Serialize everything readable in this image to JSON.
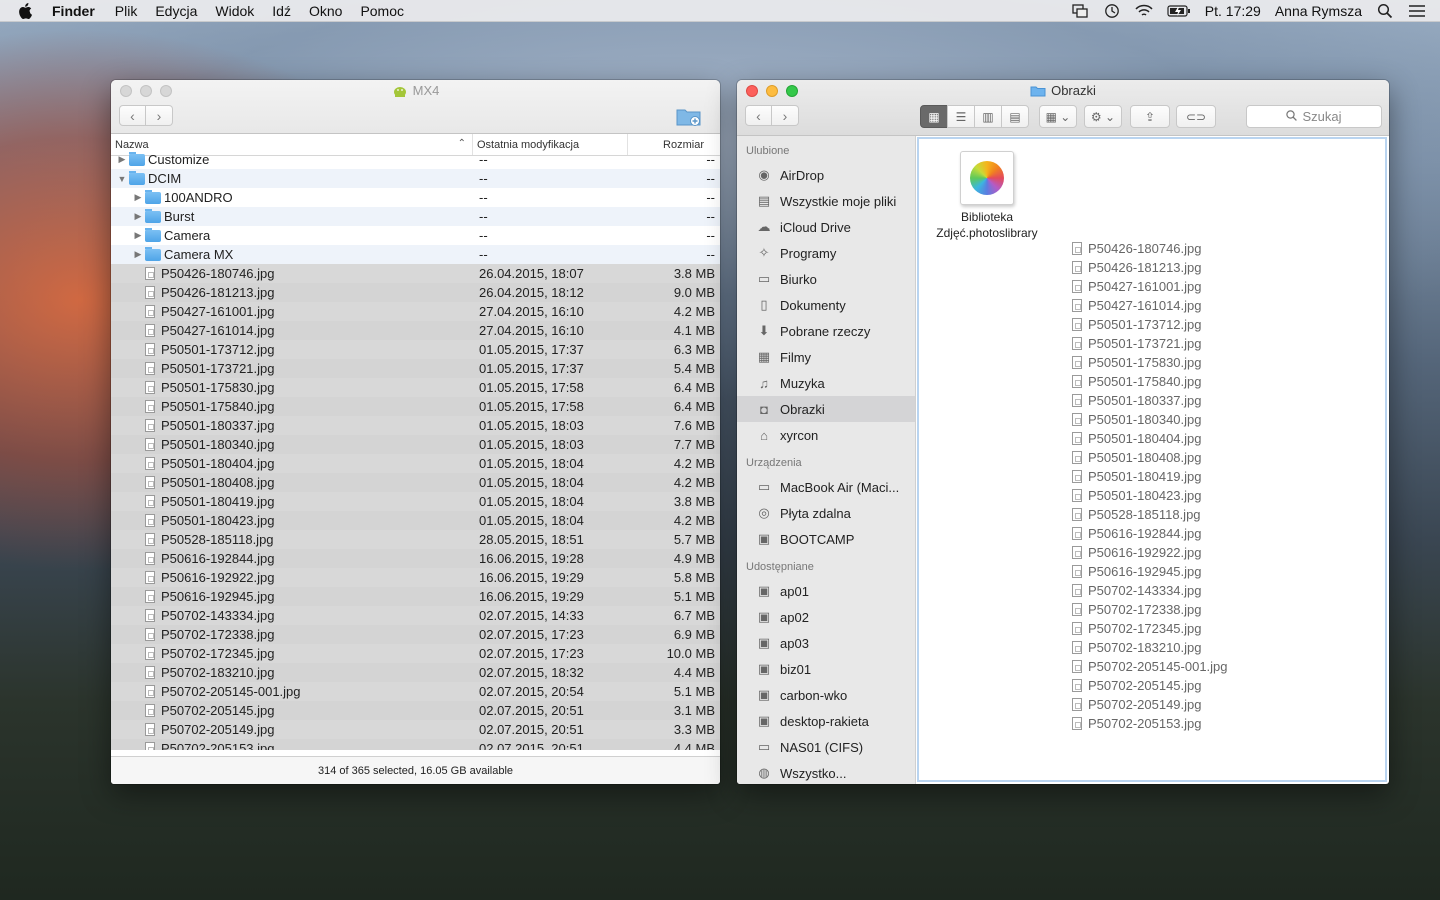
{
  "menubar": {
    "app": "Finder",
    "items": [
      "Plik",
      "Edycja",
      "Widok",
      "Idź",
      "Okno",
      "Pomoc"
    ],
    "clock": "Pt. 17:29",
    "user": "Anna Rymsza"
  },
  "mx4": {
    "title": "MX4",
    "columns": {
      "name": "Nazwa",
      "date": "Ostatnia modyfikacja",
      "size": "Rozmiar"
    },
    "rows": [
      {
        "level": 0,
        "kind": "folder",
        "tri": "▶",
        "name": "Customize",
        "date": "--",
        "size": "--",
        "sel": false
      },
      {
        "level": 0,
        "kind": "folder",
        "tri": "▼",
        "name": "DCIM",
        "date": "--",
        "size": "--",
        "sel": false
      },
      {
        "level": 1,
        "kind": "folder",
        "tri": "▶",
        "name": "100ANDRO",
        "date": "--",
        "size": "--",
        "sel": false
      },
      {
        "level": 1,
        "kind": "folder",
        "tri": "▶",
        "name": "Burst",
        "date": "--",
        "size": "--",
        "sel": false
      },
      {
        "level": 1,
        "kind": "folder",
        "tri": "▶",
        "name": "Camera",
        "date": "--",
        "size": "--",
        "sel": false
      },
      {
        "level": 1,
        "kind": "folder",
        "tri": "▶",
        "name": "Camera MX",
        "date": "--",
        "size": "--",
        "sel": false
      },
      {
        "level": 1,
        "kind": "file",
        "name": "P50426-180746.jpg",
        "date": "26.04.2015, 18:07",
        "size": "3.8 MB",
        "sel": true
      },
      {
        "level": 1,
        "kind": "file",
        "name": "P50426-181213.jpg",
        "date": "26.04.2015, 18:12",
        "size": "9.0 MB",
        "sel": true
      },
      {
        "level": 1,
        "kind": "file",
        "name": "P50427-161001.jpg",
        "date": "27.04.2015, 16:10",
        "size": "4.2 MB",
        "sel": true
      },
      {
        "level": 1,
        "kind": "file",
        "name": "P50427-161014.jpg",
        "date": "27.04.2015, 16:10",
        "size": "4.1 MB",
        "sel": true
      },
      {
        "level": 1,
        "kind": "file",
        "name": "P50501-173712.jpg",
        "date": "01.05.2015, 17:37",
        "size": "6.3 MB",
        "sel": true
      },
      {
        "level": 1,
        "kind": "file",
        "name": "P50501-173721.jpg",
        "date": "01.05.2015, 17:37",
        "size": "5.4 MB",
        "sel": true
      },
      {
        "level": 1,
        "kind": "file",
        "name": "P50501-175830.jpg",
        "date": "01.05.2015, 17:58",
        "size": "6.4 MB",
        "sel": true
      },
      {
        "level": 1,
        "kind": "file",
        "name": "P50501-175840.jpg",
        "date": "01.05.2015, 17:58",
        "size": "6.4 MB",
        "sel": true
      },
      {
        "level": 1,
        "kind": "file",
        "name": "P50501-180337.jpg",
        "date": "01.05.2015, 18:03",
        "size": "7.6 MB",
        "sel": true
      },
      {
        "level": 1,
        "kind": "file",
        "name": "P50501-180340.jpg",
        "date": "01.05.2015, 18:03",
        "size": "7.7 MB",
        "sel": true
      },
      {
        "level": 1,
        "kind": "file",
        "name": "P50501-180404.jpg",
        "date": "01.05.2015, 18:04",
        "size": "4.2 MB",
        "sel": true
      },
      {
        "level": 1,
        "kind": "file",
        "name": "P50501-180408.jpg",
        "date": "01.05.2015, 18:04",
        "size": "4.2 MB",
        "sel": true
      },
      {
        "level": 1,
        "kind": "file",
        "name": "P50501-180419.jpg",
        "date": "01.05.2015, 18:04",
        "size": "3.8 MB",
        "sel": true
      },
      {
        "level": 1,
        "kind": "file",
        "name": "P50501-180423.jpg",
        "date": "01.05.2015, 18:04",
        "size": "4.2 MB",
        "sel": true
      },
      {
        "level": 1,
        "kind": "file",
        "name": "P50528-185118.jpg",
        "date": "28.05.2015, 18:51",
        "size": "5.7 MB",
        "sel": true
      },
      {
        "level": 1,
        "kind": "file",
        "name": "P50616-192844.jpg",
        "date": "16.06.2015, 19:28",
        "size": "4.9 MB",
        "sel": true
      },
      {
        "level": 1,
        "kind": "file",
        "name": "P50616-192922.jpg",
        "date": "16.06.2015, 19:29",
        "size": "5.8 MB",
        "sel": true
      },
      {
        "level": 1,
        "kind": "file",
        "name": "P50616-192945.jpg",
        "date": "16.06.2015, 19:29",
        "size": "5.1 MB",
        "sel": true
      },
      {
        "level": 1,
        "kind": "file",
        "name": "P50702-143334.jpg",
        "date": "02.07.2015, 14:33",
        "size": "6.7 MB",
        "sel": true
      },
      {
        "level": 1,
        "kind": "file",
        "name": "P50702-172338.jpg",
        "date": "02.07.2015, 17:23",
        "size": "6.9 MB",
        "sel": true
      },
      {
        "level": 1,
        "kind": "file",
        "name": "P50702-172345.jpg",
        "date": "02.07.2015, 17:23",
        "size": "10.0 MB",
        "sel": true
      },
      {
        "level": 1,
        "kind": "file",
        "name": "P50702-183210.jpg",
        "date": "02.07.2015, 18:32",
        "size": "4.4 MB",
        "sel": true
      },
      {
        "level": 1,
        "kind": "file",
        "name": "P50702-205145-001.jpg",
        "date": "02.07.2015, 20:54",
        "size": "5.1 MB",
        "sel": true
      },
      {
        "level": 1,
        "kind": "file",
        "name": "P50702-205145.jpg",
        "date": "02.07.2015, 20:51",
        "size": "3.1 MB",
        "sel": true
      },
      {
        "level": 1,
        "kind": "file",
        "name": "P50702-205149.jpg",
        "date": "02.07.2015, 20:51",
        "size": "3.3 MB",
        "sel": true
      },
      {
        "level": 1,
        "kind": "file",
        "name": "P50702-205153.jpg",
        "date": "02.07.2015, 20:51",
        "size": "4.4 MB",
        "sel": true
      }
    ],
    "status": "314 of 365 selected, 16.05 GB available"
  },
  "obrazki": {
    "title": "Obrazki",
    "search_placeholder": "Szukaj",
    "sidebar": [
      {
        "header": "Ulubione"
      },
      {
        "label": "AirDrop",
        "icon": "airdrop-icon",
        "glyph": "◉"
      },
      {
        "label": "Wszystkie moje pliki",
        "icon": "all-files-icon",
        "glyph": "▤"
      },
      {
        "label": "iCloud Drive",
        "icon": "cloud-icon",
        "glyph": "☁"
      },
      {
        "label": "Programy",
        "icon": "applications-icon",
        "glyph": "✧"
      },
      {
        "label": "Biurko",
        "icon": "desktop-icon",
        "glyph": "▭"
      },
      {
        "label": "Dokumenty",
        "icon": "documents-icon",
        "glyph": "▯"
      },
      {
        "label": "Pobrane rzeczy",
        "icon": "downloads-icon",
        "glyph": "⬇"
      },
      {
        "label": "Filmy",
        "icon": "movies-icon",
        "glyph": "▦"
      },
      {
        "label": "Muzyka",
        "icon": "music-icon",
        "glyph": "♫"
      },
      {
        "label": "Obrazki",
        "icon": "camera-icon",
        "glyph": "◘",
        "active": true
      },
      {
        "label": "xyrcon",
        "icon": "home-icon",
        "glyph": "⌂"
      },
      {
        "header": "Urządzenia"
      },
      {
        "label": "MacBook Air (Maci...",
        "icon": "laptop-icon",
        "glyph": "▭"
      },
      {
        "label": "Płyta zdalna",
        "icon": "disc-icon",
        "glyph": "◎"
      },
      {
        "label": "BOOTCAMP",
        "icon": "drive-icon",
        "glyph": "▣"
      },
      {
        "header": "Udostępniane"
      },
      {
        "label": "ap01",
        "icon": "network-computer-icon",
        "glyph": "▣"
      },
      {
        "label": "ap02",
        "icon": "network-computer-icon",
        "glyph": "▣"
      },
      {
        "label": "ap03",
        "icon": "network-computer-icon",
        "glyph": "▣"
      },
      {
        "label": "biz01",
        "icon": "network-computer-icon",
        "glyph": "▣"
      },
      {
        "label": "carbon-wko",
        "icon": "network-computer-icon",
        "glyph": "▣"
      },
      {
        "label": "desktop-rakieta",
        "icon": "network-computer-icon",
        "glyph": "▣"
      },
      {
        "label": "NAS01 (CIFS)",
        "icon": "network-drive-icon",
        "glyph": "▭"
      },
      {
        "label": "Wszystko...",
        "icon": "globe-icon",
        "glyph": "◍"
      }
    ],
    "library": {
      "line1": "Biblioteka",
      "line2": "Zdjęć.photoslibrary"
    },
    "files": [
      "P50426-180746.jpg",
      "P50426-181213.jpg",
      "P50427-161001.jpg",
      "P50427-161014.jpg",
      "P50501-173712.jpg",
      "P50501-173721.jpg",
      "P50501-175830.jpg",
      "P50501-175840.jpg",
      "P50501-180337.jpg",
      "P50501-180340.jpg",
      "P50501-180404.jpg",
      "P50501-180408.jpg",
      "P50501-180419.jpg",
      "P50501-180423.jpg",
      "P50528-185118.jpg",
      "P50616-192844.jpg",
      "P50616-192922.jpg",
      "P50616-192945.jpg",
      "P50702-143334.jpg",
      "P50702-172338.jpg",
      "P50702-172345.jpg",
      "P50702-183210.jpg",
      "P50702-205145-001.jpg",
      "P50702-205145.jpg",
      "P50702-205149.jpg",
      "P50702-205153.jpg"
    ]
  }
}
